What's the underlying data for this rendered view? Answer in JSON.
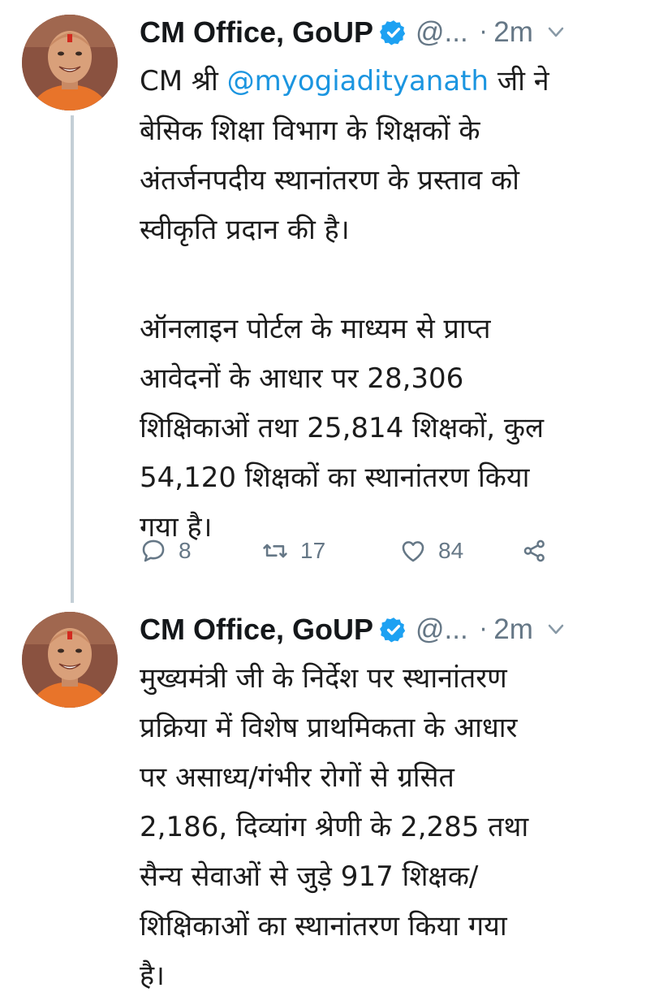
{
  "tweets": [
    {
      "author_name": "CM Office, GoUP",
      "handle": "@...",
      "time": "2m",
      "lines": [
        {
          "prefix": "CM श्री ",
          "mention": "@myogiadityanath",
          "suffix": " जी ने"
        },
        "बेसिक शिक्षा विभाग के शिक्षकों के",
        "अंतर्जनपदीय स्थानांतरण के प्रस्ताव को",
        "स्वीकृति प्रदान की है।",
        "",
        "ऑनलाइन पोर्टल के माध्यम से प्राप्त",
        "आवेदनों के आधार पर 28,306",
        "शिक्षिकाओं तथा 25,814 शिक्षकों, कुल",
        "54,120 शिक्षकों का स्थानांतरण किया",
        "गया है।"
      ],
      "actions": {
        "reply_count": "8",
        "retweet_count": "17",
        "like_count": "84"
      }
    },
    {
      "author_name": "CM Office, GoUP",
      "handle": "@...",
      "time": "2m",
      "lines": [
        "मुख्यमंत्री जी के निर्देश पर स्थानांतरण",
        "प्रक्रिया में विशेष प्राथमिकता के आधार",
        "पर असाध्य/गंभीर रोगों से ग्रसित",
        "2,186, दिव्यांग श्रेणी के 2,285 तथा",
        "सैन्य सेवाओं से जुड़े 917 शिक्षक/",
        "शिक्षिकाओं का स्थानांतरण किया गया",
        "है।"
      ]
    }
  ],
  "icons": {
    "verified": "verified-badge-icon",
    "menu": "chevron-down-icon",
    "reply": "reply-icon",
    "retweet": "retweet-icon",
    "like": "heart-icon",
    "share": "share-icon"
  },
  "colors": {
    "verified": "#1da1f2",
    "mention": "#1b95e0",
    "muted": "#657786",
    "thread_line": "#c4cfd6"
  }
}
